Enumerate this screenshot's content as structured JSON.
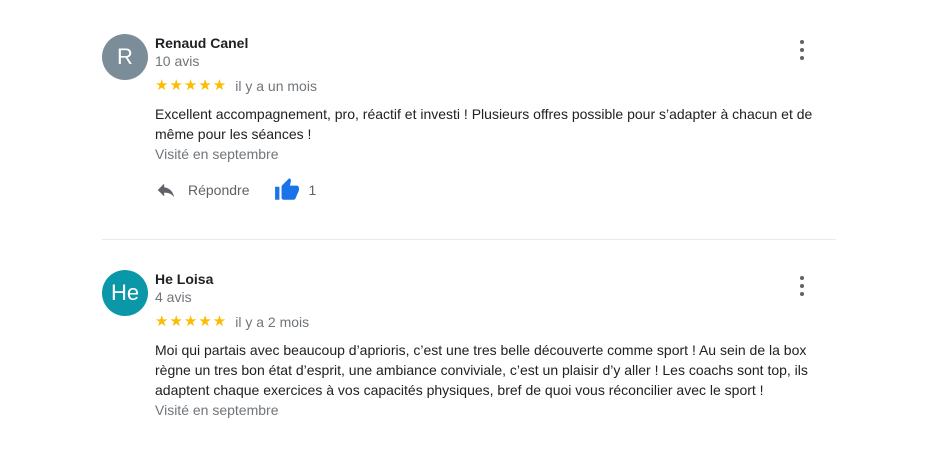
{
  "reviews": [
    {
      "avatar_letter": "R",
      "avatar_color": "#7b8d98",
      "name": "Renaud Canel",
      "count": "10 avis",
      "stars": "★★★★★",
      "date": "il y a un mois",
      "text": "Excellent accompagnement, pro, réactif et investi ! Plusieurs offres possible pour s’adapter à chacun et de même pour les séances !",
      "visited": "Visité en septembre",
      "reply_label": "Répondre",
      "like_count": "1"
    },
    {
      "avatar_letter": "He",
      "avatar_color": "#0a97a8",
      "name": "He Loisa",
      "count": "4 avis",
      "stars": "★★★★★",
      "date": "il y a 2 mois",
      "text": "Moi qui partais avec beaucoup d’aprioris, c’est une tres belle découverte comme sport ! Au sein de la box règne un tres bon état d’esprit, une ambiance conviviale, c’est un plaisir d’y aller ! Les coachs sont top, ils adaptent chaque exercices à vos capacités physiques, bref de quoi vous réconcilier avec le sport !",
      "visited": "Visité en septembre"
    }
  ],
  "icons": {
    "reply": "reply-arrow-icon",
    "like": "thumbs-up-icon",
    "more": "more-vert-icon"
  },
  "colors": {
    "star": "#fbbc04",
    "like": "#1a73e8",
    "secondary_text": "#70757a"
  }
}
